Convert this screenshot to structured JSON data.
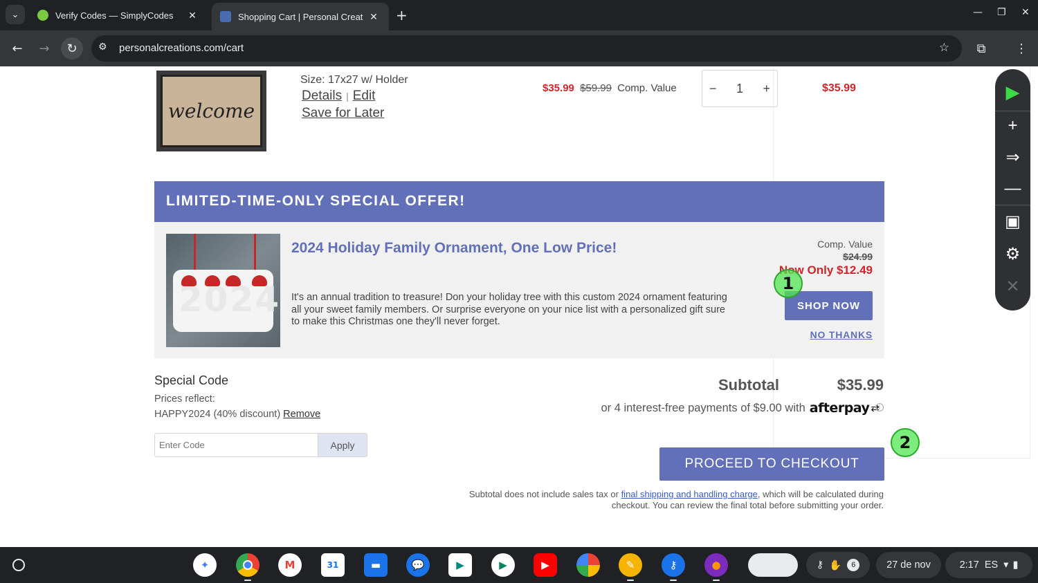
{
  "browser": {
    "tabs": [
      {
        "title": "Verify Codes — SimplyCodes",
        "active": false
      },
      {
        "title": "Shopping Cart | Personal Creat",
        "active": true
      }
    ],
    "url": "personalcreations.com/cart"
  },
  "cart_item": {
    "image_text": "welcome",
    "size": "Size: 17x27 w/ Holder",
    "details_label": "Details",
    "separator": "|",
    "edit_label": "Edit",
    "save_for_later_label": "Save for Later",
    "price_now": "$35.99",
    "price_was": "$59.99",
    "comp_value_label": "Comp. Value",
    "quantity": "1",
    "minus_label": "−",
    "plus_label": "+",
    "line_total": "$35.99"
  },
  "offer": {
    "header": "LIMITED-TIME-ONLY SPECIAL OFFER!",
    "image_year": "2024",
    "title": "2024 Holiday Family Ornament, One Low Price!",
    "description": "It's an annual tradition to treasure! Don your holiday tree with this custom 2024 ornament featuring all your sweet family members. Or surprise everyone on your nice list with a personalized gift sure to make this Christmas one they'll never forget.",
    "comp_value_label": "Comp. Value",
    "comp_value": "$24.99",
    "now_only": "Now Only $12.49",
    "shop_now": "SHOP NOW",
    "no_thanks": "NO THANKS"
  },
  "special_code": {
    "title": "Special Code",
    "prices_reflect": "Prices reflect:",
    "applied_code": "HAPPY2024 (40% discount)",
    "remove_label": "Remove",
    "input_placeholder": "Enter Code",
    "apply_label": "Apply"
  },
  "summary": {
    "subtotal_label": "Subtotal",
    "subtotal_value": "$35.99",
    "afterpay_text": "or 4 interest-free payments of $9.00 with",
    "afterpay_brand": "afterpay",
    "checkout_label": "PROCEED TO CHECKOUT",
    "disclaimer_pre": "Subtotal does not include sales tax or",
    "disclaimer_link": "final shipping and handling charge",
    "disclaimer_post": ", which will be calculated during checkout. You can review the final total before submitting your order."
  },
  "markers": [
    "1",
    "2"
  ],
  "shelf": {
    "date": "27 de nov",
    "time": "2:17",
    "lang": "ES",
    "notif_count": "6",
    "calendar_day": "31"
  },
  "colors": {
    "accent": "#6170b8",
    "sale_red": "#d0262b",
    "marker_green": "#50e650"
  }
}
